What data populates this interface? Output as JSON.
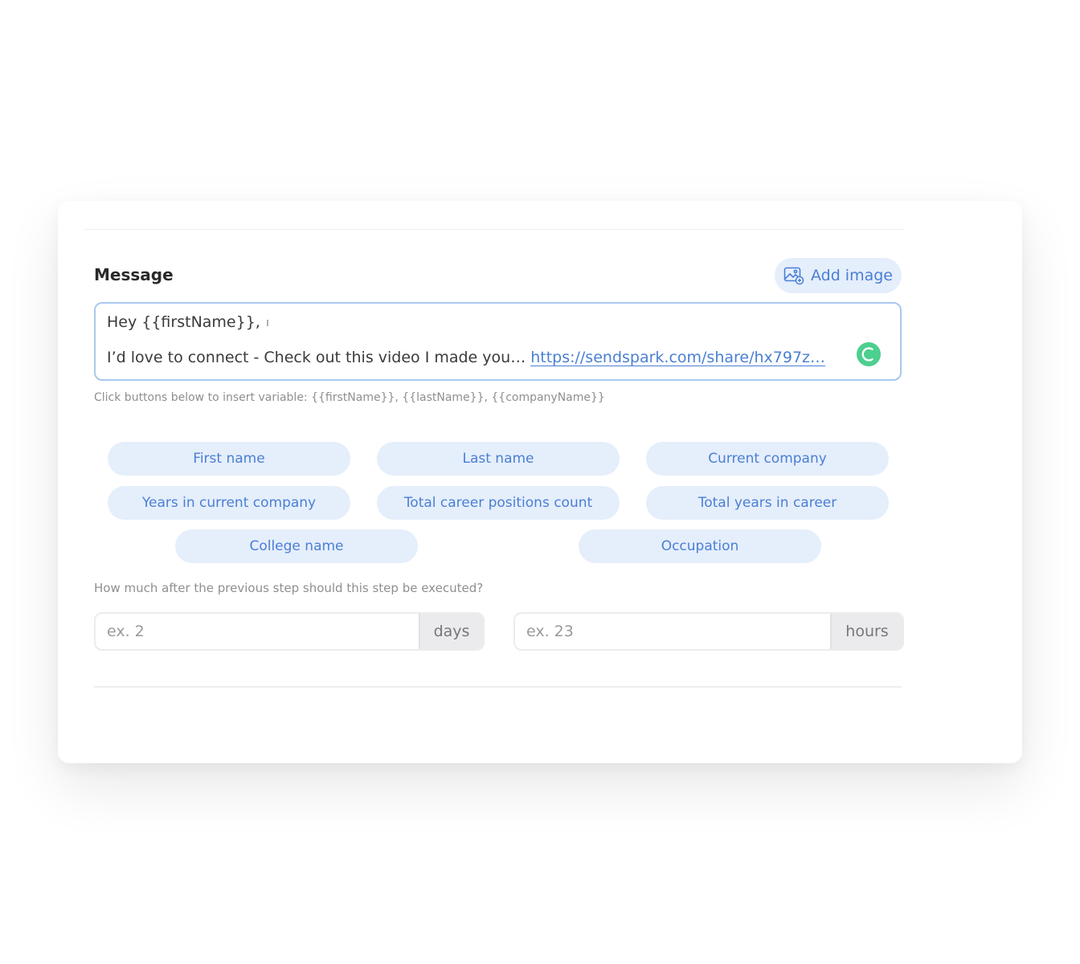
{
  "message": {
    "label": "Message",
    "add_image_label": "Add image",
    "line1": "Hey {{firstName}},",
    "line2_text": "I’d love to connect - Check out this video I made you…",
    "line2_link": "https://sendspark.com/share/hx797z…",
    "hint": "Click buttons below to insert variable: {{firstName}}, {{lastName}}, {{companyName}}"
  },
  "variables": [
    {
      "label": "First name"
    },
    {
      "label": "Last name"
    },
    {
      "label": "Current company"
    },
    {
      "label": "Years in current company"
    },
    {
      "label": "Total career positions count"
    },
    {
      "label": "Total years in career"
    },
    {
      "label": "College name"
    },
    {
      "label": "Occupation"
    }
  ],
  "delay": {
    "question": "How much after the previous step should this step be executed?",
    "days_placeholder": "ex. 2",
    "days_unit": "days",
    "hours_placeholder": "ex. 23",
    "hours_unit": "hours"
  },
  "colors": {
    "accent": "#4a7fd4",
    "chip_bg": "#e5eefb",
    "status_green": "#4ccf8f"
  },
  "icons": {
    "add_image": "image-add-icon",
    "status": "grammar-check-icon"
  }
}
